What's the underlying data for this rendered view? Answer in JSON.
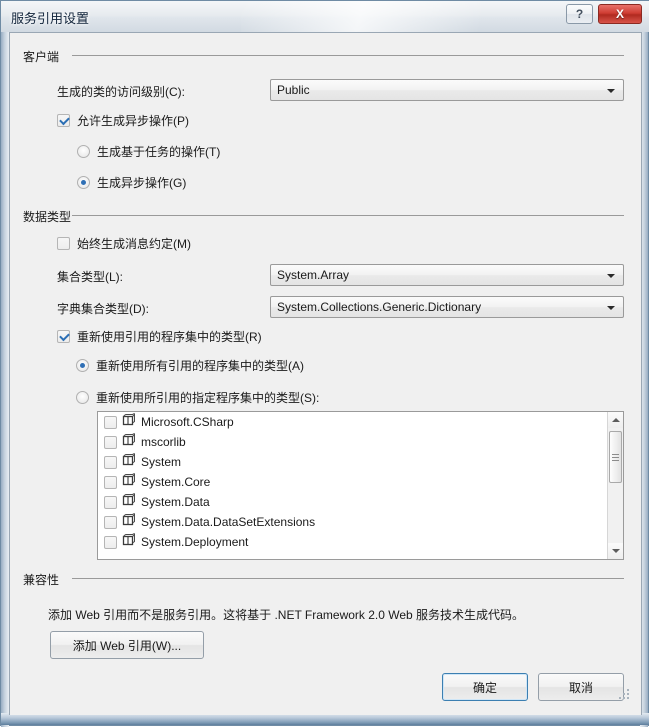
{
  "window": {
    "title": "服务引用设置",
    "help_label": "?",
    "close_label": "X",
    "help_icon": "question-mark-icon",
    "close_icon": "close-x-icon"
  },
  "client_group": {
    "label": "客户端",
    "access_level_label": "生成的类的访问级别(C):",
    "access_level_value": "Public",
    "allow_async_label": "允许生成异步操作(P)",
    "allow_async_checked": true,
    "task_based_label": "生成基于任务的操作(T)",
    "task_based_selected": false,
    "async_label": "生成异步操作(G)",
    "async_selected": true
  },
  "data_types_group": {
    "label": "数据类型",
    "always_message_contract_label": "始终生成消息约定(M)",
    "always_message_contract_checked": false,
    "collection_type_label": "集合类型(L):",
    "collection_type_value": "System.Array",
    "dictionary_type_label": "字典集合类型(D):",
    "dictionary_type_value": "System.Collections.Generic.Dictionary",
    "reuse_types_label": "重新使用引用的程序集中的类型(R)",
    "reuse_types_checked": true,
    "reuse_all_label": "重新使用所有引用的程序集中的类型(A)",
    "reuse_all_selected": true,
    "reuse_specified_label": "重新使用所引用的指定程序集中的类型(S):",
    "reuse_specified_selected": false,
    "assemblies": [
      {
        "name": "Microsoft.CSharp",
        "checked": false
      },
      {
        "name": "mscorlib",
        "checked": false
      },
      {
        "name": "System",
        "checked": false
      },
      {
        "name": "System.Core",
        "checked": false
      },
      {
        "name": "System.Data",
        "checked": false
      },
      {
        "name": "System.Data.DataSetExtensions",
        "checked": false
      },
      {
        "name": "System.Deployment",
        "checked": false
      }
    ]
  },
  "compatibility_group": {
    "label": "兼容性",
    "description": "添加 Web 引用而不是服务引用。这将基于 .NET Framework 2.0 Web 服务技术生成代码。",
    "add_web_reference_label": "添加 Web 引用(W)..."
  },
  "footer": {
    "ok_label": "确定",
    "cancel_label": "取消"
  },
  "colors": {
    "accent": "#3c7fb1",
    "close_button": "#cf3d33",
    "dialog_background": "#f0f0f0",
    "check_mark": "#2c6fb5"
  }
}
